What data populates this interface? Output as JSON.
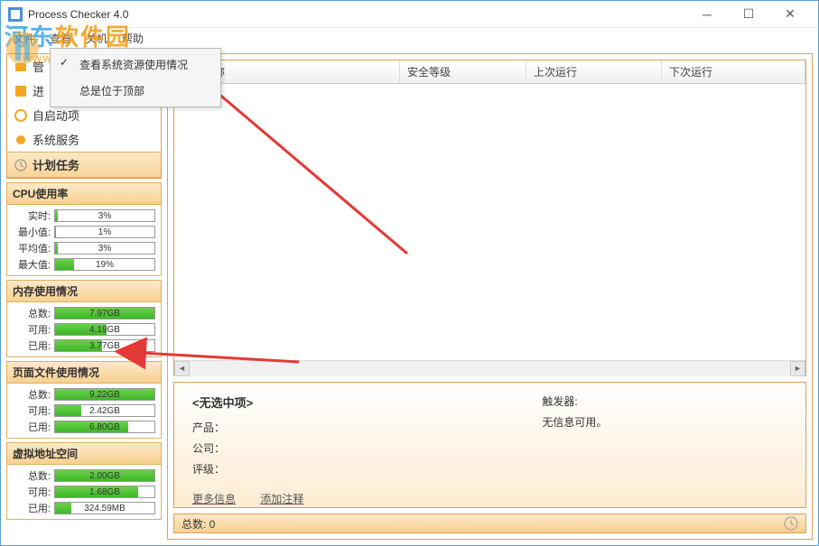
{
  "title": "Process Checker 4.0",
  "menus": [
    "文件",
    "查看",
    "关机",
    "帮助"
  ],
  "dropdown": {
    "item1": "查看系统资源使用情况",
    "item2": "总是位于顶部"
  },
  "nav": {
    "item0": "管",
    "item1": "进",
    "item2": "自启动项",
    "item3": "系统服务",
    "item4": "计划任务"
  },
  "cpu": {
    "header": "CPU使用率",
    "rows": [
      {
        "label": "实时:",
        "pct": 3,
        "text": "3%"
      },
      {
        "label": "最小值:",
        "pct": 1,
        "text": "1%"
      },
      {
        "label": "平均值:",
        "pct": 3,
        "text": "3%"
      },
      {
        "label": "最大值:",
        "pct": 19,
        "text": "19%"
      }
    ]
  },
  "mem": {
    "header": "内存使用情况",
    "rows": [
      {
        "label": "总数:",
        "pct": 100,
        "text": "7.97GB"
      },
      {
        "label": "可用:",
        "pct": 52,
        "text": "4.19GB"
      },
      {
        "label": "已用:",
        "pct": 47,
        "text": "3.77GB"
      }
    ]
  },
  "pagefile": {
    "header": "页面文件使用情况",
    "rows": [
      {
        "label": "总数:",
        "pct": 100,
        "text": "9.22GB"
      },
      {
        "label": "可用:",
        "pct": 26,
        "text": "2.42GB"
      },
      {
        "label": "已用:",
        "pct": 74,
        "text": "6.80GB"
      }
    ]
  },
  "vmem": {
    "header": "虚拟地址空间",
    "rows": [
      {
        "label": "总数:",
        "pct": 100,
        "text": "2.00GB"
      },
      {
        "label": "可用:",
        "pct": 84,
        "text": "1.68GB"
      },
      {
        "label": "已用:",
        "pct": 16,
        "text": "324.59MB"
      }
    ]
  },
  "table": {
    "cols": [
      "任务名称",
      "安全等级",
      "上次运行",
      "下次运行"
    ]
  },
  "details": {
    "heading": "<无选中项>",
    "product_label": "产品：",
    "company_label": "公司：",
    "rating_label": "评级：",
    "more_link": "更多信息",
    "note_link": "添加注释",
    "trigger_label": "触发器:",
    "trigger_value": "无信息可用。"
  },
  "status": "总数: 0",
  "watermark": {
    "text1": "河东",
    "text2": "软件园",
    "url": "www.pc0359.cn"
  }
}
